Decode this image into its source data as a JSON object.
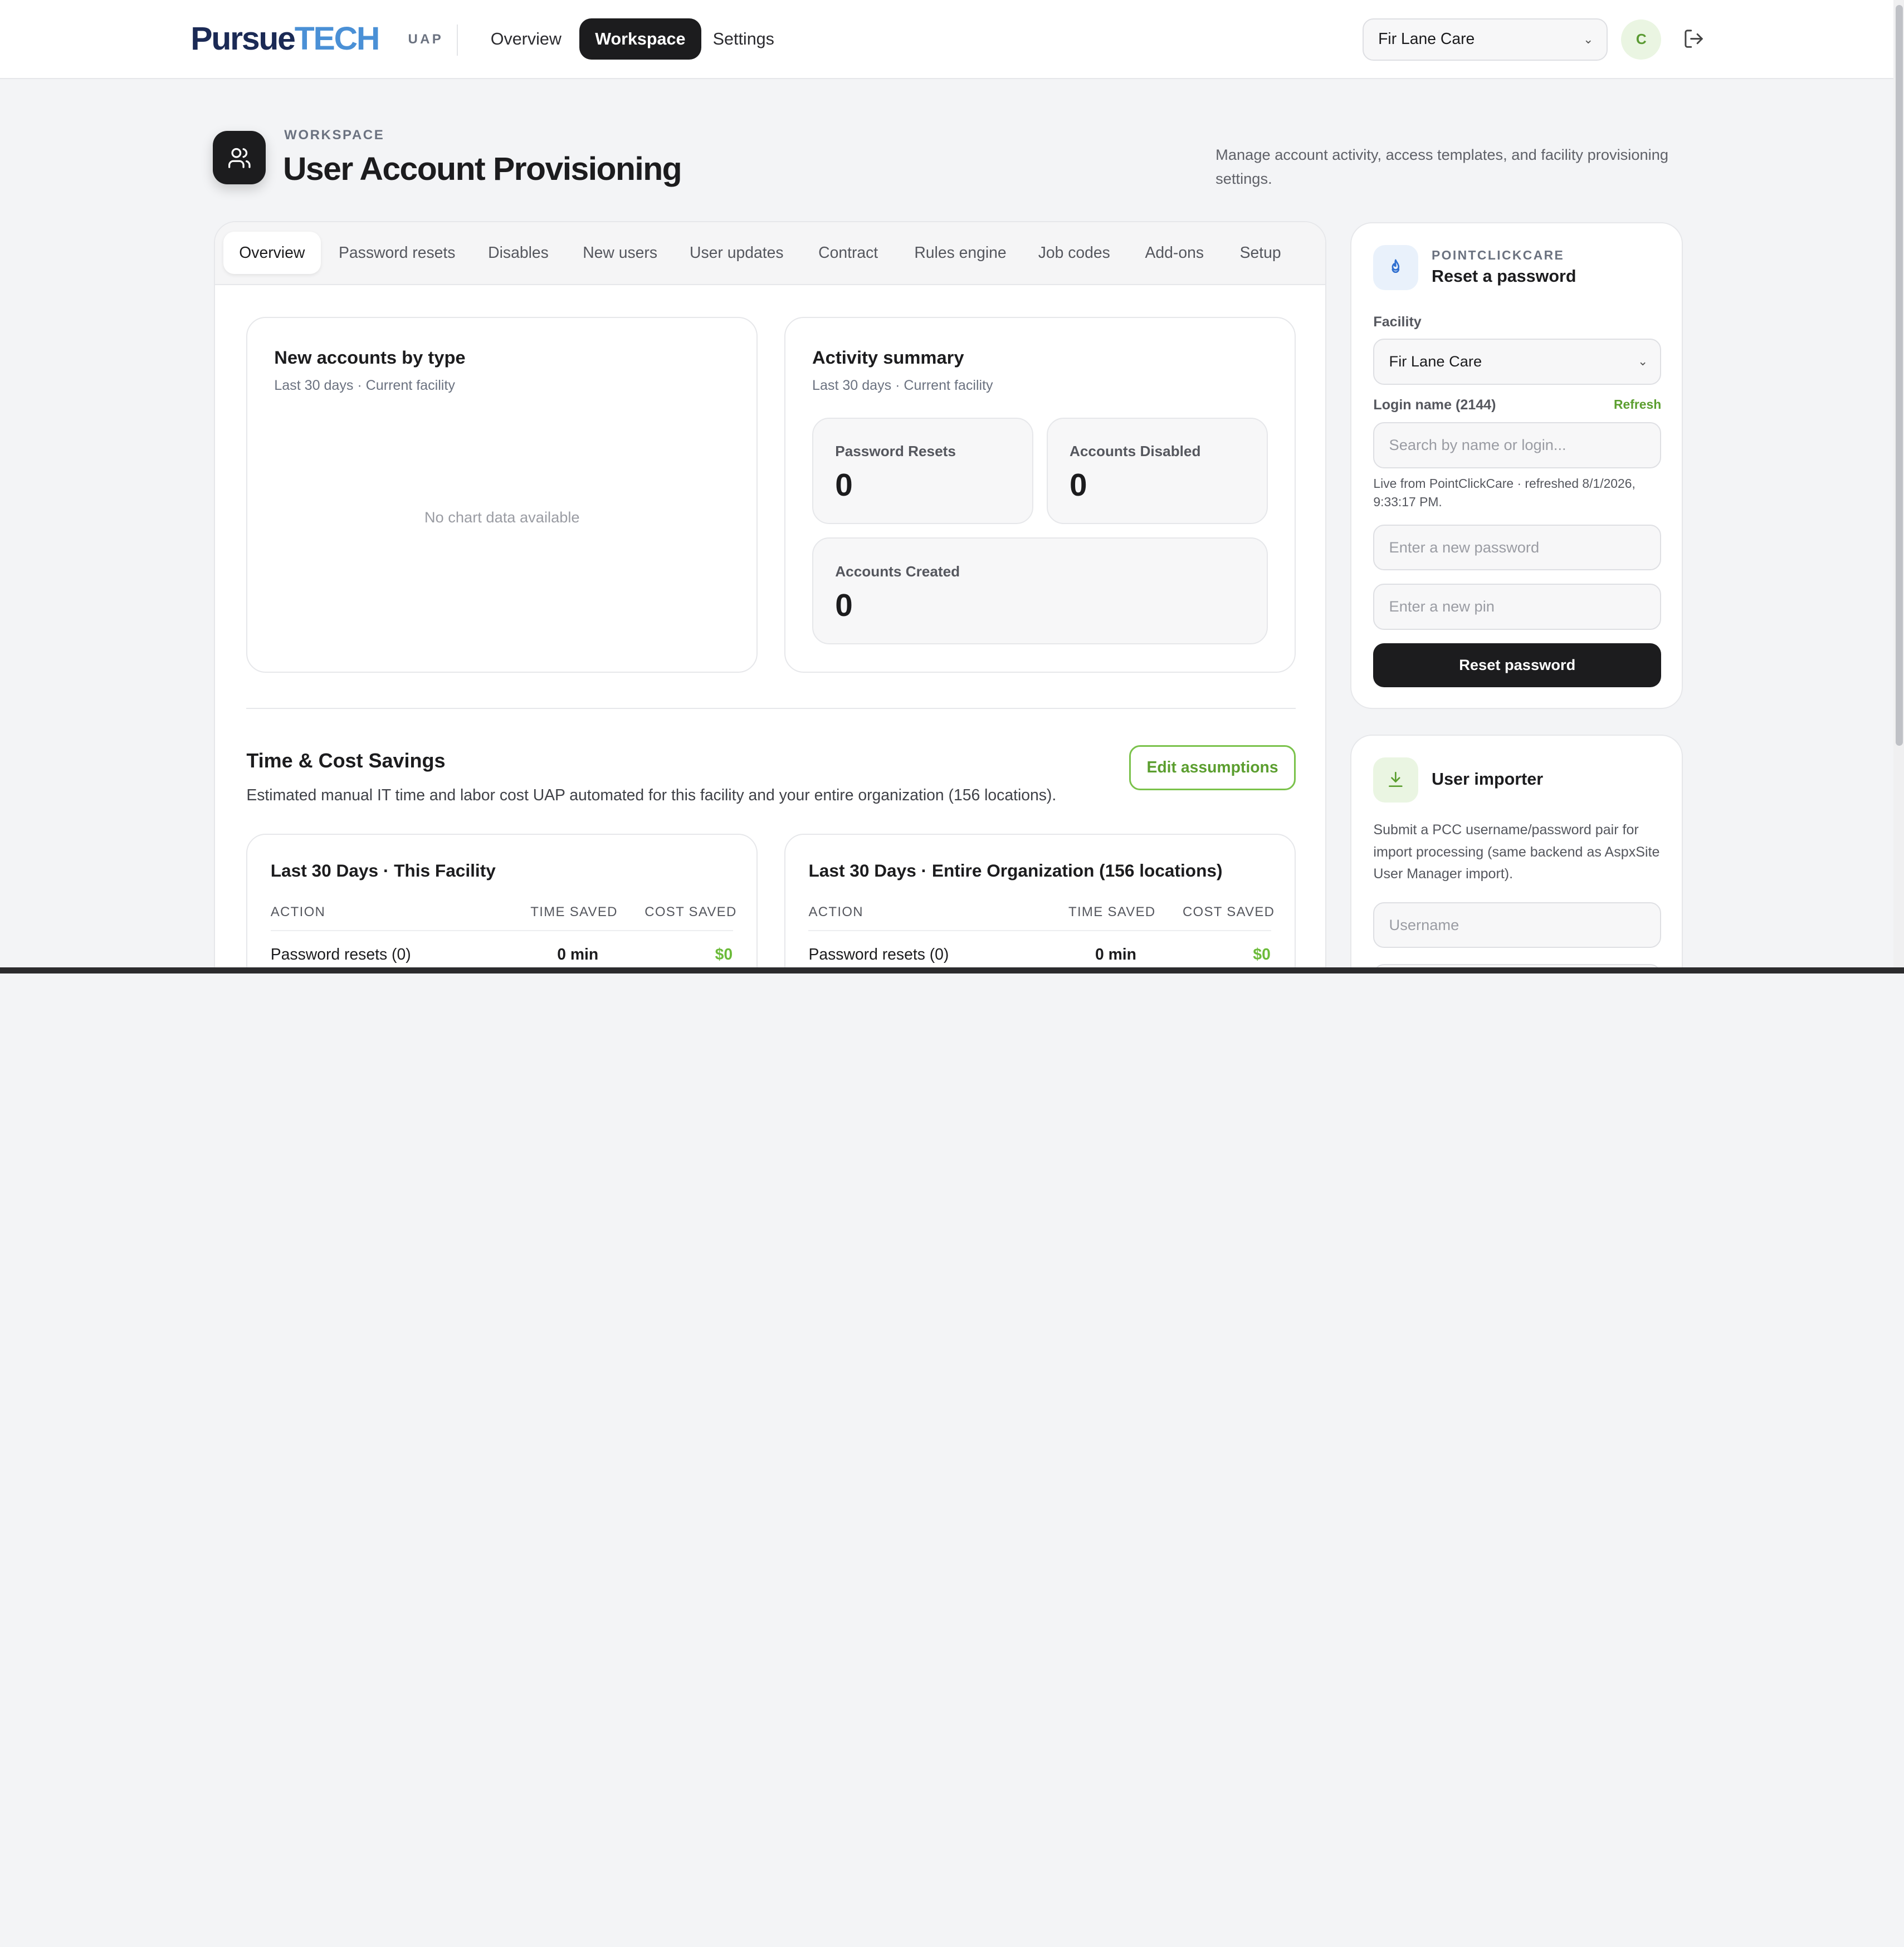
{
  "nav": {
    "brand_part1": "Pursue",
    "brand_part2": "TECH",
    "product_tag": "UAP",
    "links": [
      "Overview",
      "Workspace",
      "Settings"
    ],
    "active_link": "Workspace",
    "facility_select": "Fir Lane Care",
    "avatar_initial": "C",
    "logout_icon": "logout-icon"
  },
  "header": {
    "eyebrow": "WORKSPACE",
    "title": "User Account Provisioning",
    "description": "Manage account activity, access templates, and facility provisioning settings.",
    "icon": "users-icon"
  },
  "tabs": [
    "Overview",
    "Password resets",
    "Disables",
    "New users",
    "User updates",
    "Contract",
    "Rules engine",
    "Job codes",
    "Add-ons",
    "Setup"
  ],
  "active_tab": "Overview",
  "new_accounts": {
    "title": "New accounts by type",
    "subtitle": "Last 30 days · Current facility",
    "empty_message": "No chart data available"
  },
  "activity": {
    "title": "Activity summary",
    "subtitle": "Last 30 days · Current facility",
    "stats": [
      {
        "label": "Password Resets",
        "value": "0"
      },
      {
        "label": "Accounts Disabled",
        "value": "0"
      },
      {
        "label": "Accounts Created",
        "value": "0"
      }
    ]
  },
  "savings": {
    "title": "Time & Cost Savings",
    "description": "Estimated manual IT time and labor cost UAP automated for this facility and your entire organization (156 locations).",
    "edit_button": "Edit assumptions",
    "columns": [
      "ACTION",
      "TIME SAVED",
      "COST SAVED"
    ],
    "facility_table": {
      "title": "Last 30 Days · This Facility",
      "rows": [
        {
          "action": "Password resets (0)",
          "time": "0 min",
          "cost": "$0"
        }
      ]
    },
    "org_table": {
      "title": "Last 30 Days · Entire Organization (156 locations)",
      "rows": [
        {
          "action": "Password resets (0)",
          "time": "0 min",
          "cost": "$0"
        }
      ]
    }
  },
  "reset_card": {
    "eyebrow": "POINTCLICKCARE",
    "title": "Reset a password",
    "facility_label": "Facility",
    "facility_value": "Fir Lane Care",
    "login_label": "Login name (2144)",
    "refresh_label": "Refresh",
    "search_placeholder": "Search by name or login...",
    "helper": "Live from PointClickCare · refreshed 8/1/2026, 9:33:17 PM.",
    "password_placeholder": "Enter a new password",
    "pin_placeholder": "Enter a new pin",
    "submit": "Reset password"
  },
  "importer_card": {
    "title": "User importer",
    "description": "Submit a PCC username/password pair for import processing (same backend as AspxSite User Manager import).",
    "username_placeholder": "Username"
  },
  "colors": {
    "accent_green": "#6cbb3a",
    "dark": "#1c1c1e",
    "brand_navy": "#1b2a55",
    "brand_blue": "#4a90d6"
  }
}
